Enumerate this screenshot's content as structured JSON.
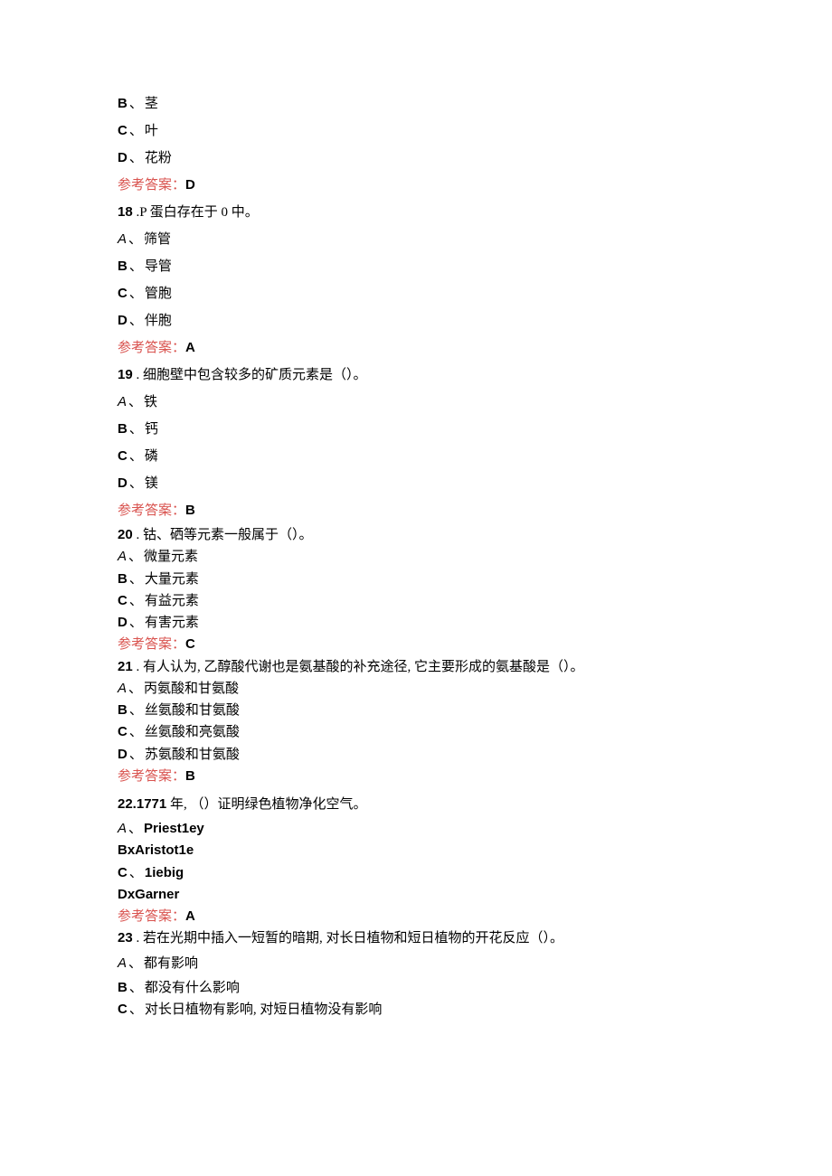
{
  "q17": {
    "optB": {
      "letter": "B",
      "text": "茎"
    },
    "optC": {
      "letter": "C",
      "text": "叶"
    },
    "optD": {
      "letter": "D",
      "text": "花粉"
    },
    "answerLabel": "参考答案：",
    "answerValue": "D"
  },
  "q18": {
    "num": "18",
    "text": " .P 蛋白存在于 0 中。",
    "optA": {
      "letter": "A",
      "text": "筛管"
    },
    "optB": {
      "letter": "B",
      "text": "导管"
    },
    "optC": {
      "letter": "C",
      "text": "管胞"
    },
    "optD": {
      "letter": "D",
      "text": "伴胞"
    },
    "answerLabel": "参考答案：",
    "answerValue": "A"
  },
  "q19": {
    "num": "19",
    "text": " . 细胞壁中包含较多的矿质元素是（）。",
    "optA": {
      "letter": "A",
      "text": "铁"
    },
    "optB": {
      "letter": "B",
      "text": "钙"
    },
    "optC": {
      "letter": "C",
      "text": "磷"
    },
    "optD": {
      "letter": "D",
      "text": "镁"
    },
    "answerLabel": "参考答案：",
    "answerValue": "B"
  },
  "q20": {
    "num": "20",
    "text": " . 钴、硒等元素一般属于（）。",
    "optA": {
      "letter": "A",
      "text": "微量元素"
    },
    "optB": {
      "letter": "B",
      "text": "大量元素"
    },
    "optC": {
      "letter": "C",
      "text": "有益元素"
    },
    "optD": {
      "letter": "D",
      "text": "有害元素"
    },
    "answerLabel": "参考答案：",
    "answerValue": "C"
  },
  "q21": {
    "num": "21",
    "text": " . 有人认为, 乙醇酸代谢也是氨基酸的补充途径, 它主要形成的氨基酸是（）。",
    "optA": {
      "letter": "A",
      "text": "丙氨酸和甘氨酸"
    },
    "optB": {
      "letter": "B",
      "text": "丝氨酸和甘氨酸"
    },
    "optC": {
      "letter": "C",
      "text": "丝氨酸和亮氨酸"
    },
    "optD": {
      "letter": "D",
      "text": "苏氨酸和甘氨酸"
    },
    "answerLabel": "参考答案：",
    "answerValue": "B"
  },
  "q22": {
    "num": "22.1771",
    "text": " 年, （）证明绿色植物净化空气。",
    "optA": {
      "letter": "A",
      "text": "Priest1ey"
    },
    "optB": {
      "letter": "BxAristot1e",
      "text": ""
    },
    "optC": {
      "letter": "C",
      "text": "1iebig"
    },
    "optD": {
      "letter": "DxGarner",
      "text": ""
    },
    "answerLabel": "参考答案：",
    "answerValue": "A"
  },
  "q23": {
    "num": "23",
    "text": " . 若在光期中插入一短暂的暗期, 对长日植物和短日植物的开花反应（）。",
    "optA": {
      "letter": "A",
      "text": "都有影响"
    },
    "optB": {
      "letter": "B",
      "text": "都没有什么影响"
    },
    "optC": {
      "letter": "C",
      "text": "对长日植物有影响, 对短日植物没有影响"
    }
  },
  "sep": "、"
}
